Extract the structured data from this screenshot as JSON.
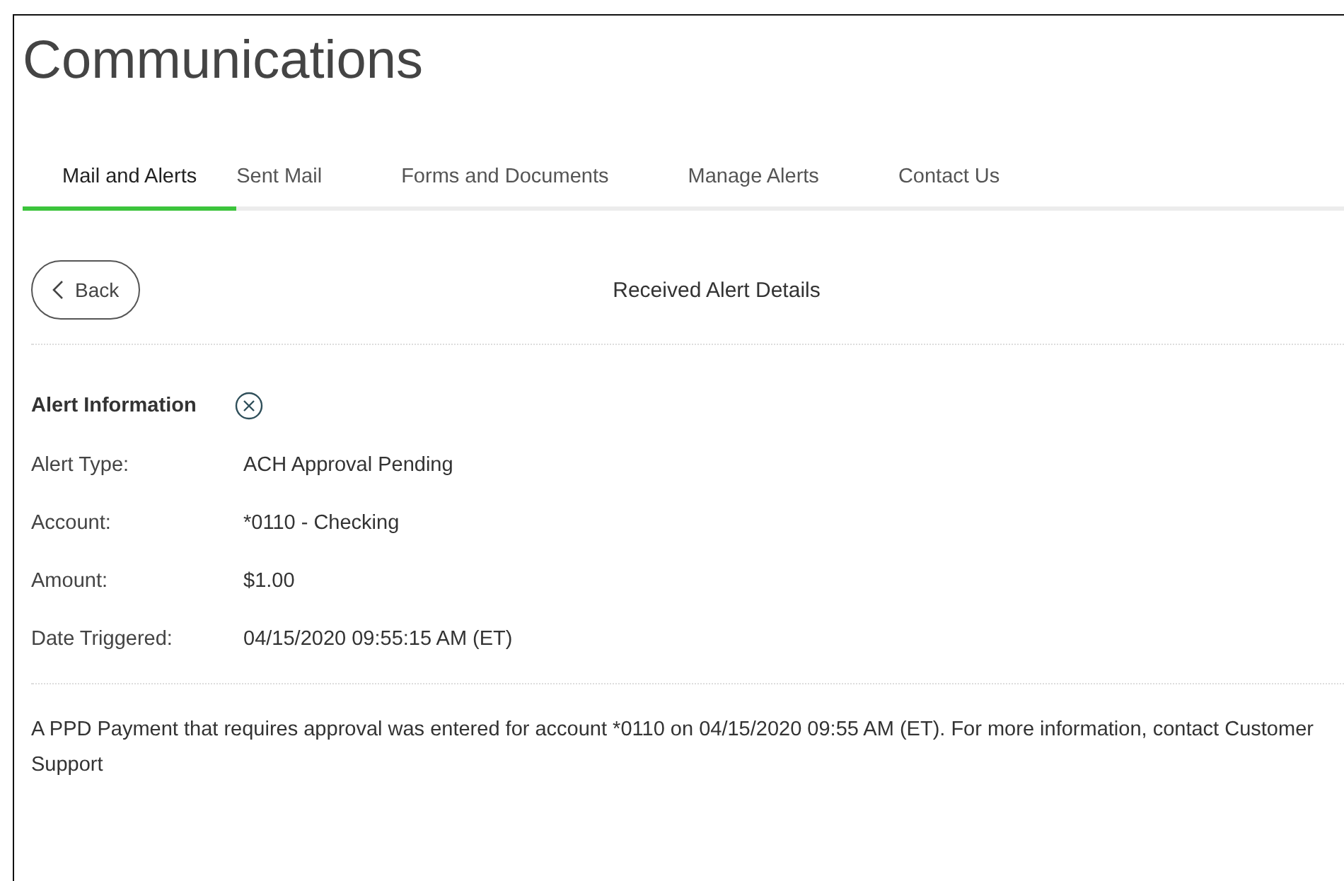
{
  "page_title": "Communications",
  "tabs": [
    {
      "label": "Mail and Alerts",
      "selected": true
    },
    {
      "label": "Sent Mail",
      "selected": false
    },
    {
      "label": "Forms and Documents",
      "selected": false
    },
    {
      "label": "Manage Alerts",
      "selected": false
    },
    {
      "label": "Contact Us",
      "selected": false
    }
  ],
  "back_button": {
    "label": "Back"
  },
  "detail_title": "Received Alert Details",
  "section_title": "Alert Information",
  "fields": [
    {
      "label": "Alert Type:",
      "value": "ACH Approval Pending"
    },
    {
      "label": "Account:",
      "value": "*0110 - Checking"
    },
    {
      "label": "Amount:",
      "value": "$1.00"
    },
    {
      "label": "Date Triggered:",
      "value": "04/15/2020 09:55:15 AM (ET)"
    }
  ],
  "message": "A PPD Payment that requires approval was entered for account *0110 on 04/15/2020 09:55 AM (ET). For more information, contact Customer Support"
}
